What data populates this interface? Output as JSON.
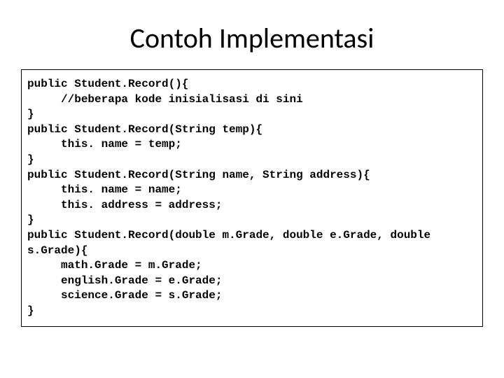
{
  "title": "Contoh Implementasi",
  "code": "public Student.Record(){\n     //beberapa kode inisialisasi di sini\n}\npublic Student.Record(String temp){\n     this. name = temp;\n}\npublic Student.Record(String name, String address){\n     this. name = name;\n     this. address = address;\n}\npublic Student.Record(double m.Grade, double e.Grade, double s.Grade){\n     math.Grade = m.Grade;\n     english.Grade = e.Grade;\n     science.Grade = s.Grade;\n}"
}
